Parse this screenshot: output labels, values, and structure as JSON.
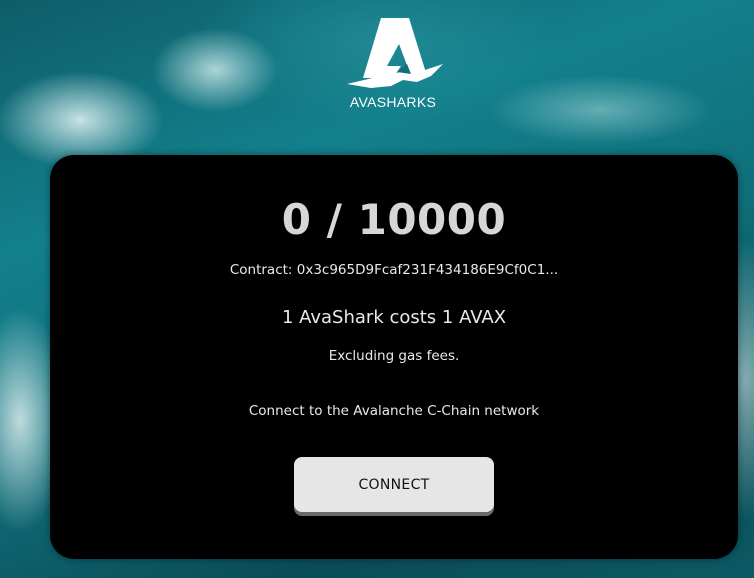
{
  "brand": {
    "name": "AVASHARKS",
    "logo_icon": "avasharks-logo-icon"
  },
  "mint": {
    "supply_text": "0 / 10000",
    "contract_text": "Contract: 0x3c965D9Fcaf231F434186E9Cf0C1...",
    "cost_text": "1 AvaShark costs 1 AVAX",
    "gas_note": "Excluding gas fees.",
    "network_text": "Connect to the Avalanche C-Chain network",
    "connect_label": "CONNECT"
  },
  "colors": {
    "card_background": "#000000",
    "button_background": "#e6e6e6",
    "supply_text": "#d6d6d6"
  }
}
